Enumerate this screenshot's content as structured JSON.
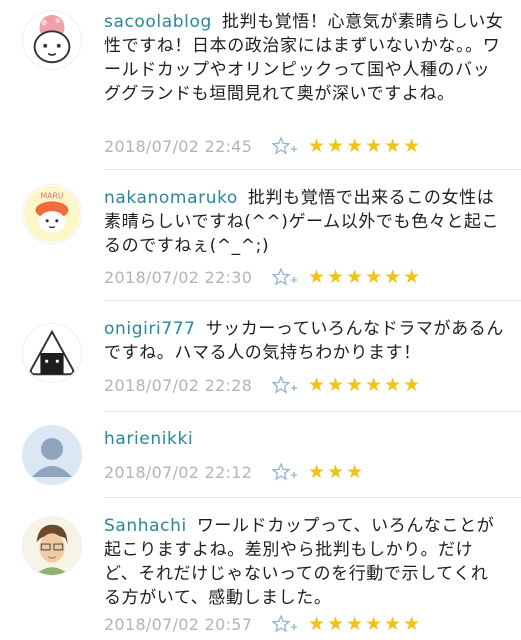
{
  "comments": [
    {
      "username": "sacoolablog",
      "text": "批判も覚悟！心意気が素晴らしい女性ですね！日本の政治家にはまずいないかな。。ワールドカップやオリンピックって国や人種のバッググランドも垣間見れて奥が深いですよね。",
      "timestamp": "2018/07/02 22:45",
      "stars": "★★★★★★",
      "rating": 6,
      "avatar_icon": "pink-hair-girl-avatar"
    },
    {
      "username": "nakanomaruko",
      "text": "批判も覚悟で出来るこの女性は素晴らしいですね(^^)ゲーム以外でも色々と起こるのですねぇ(^_^;)",
      "timestamp": "2018/07/02 22:30",
      "stars": "★★★★★★",
      "rating": 6,
      "avatar_icon": "maru-character-avatar",
      "avatar_text": "MARU"
    },
    {
      "username": "onigiri777",
      "text": "サッカーっていろんなドラマがあるんですね。ハマる人の気持ちわかります！",
      "timestamp": "2018/07/02 22:28",
      "stars": "★★★★★★",
      "rating": 6,
      "avatar_icon": "onigiri-avatar"
    },
    {
      "username": "harienikki",
      "text": "",
      "timestamp": "2018/07/02 22:12",
      "stars": "★★★",
      "rating": 3,
      "avatar_icon": "default-user-avatar"
    },
    {
      "username": "Sanhachi",
      "text": "ワールドカップって、いろんなことが起こりますよね。差別やら批判もしかり。だけど、それだけじゃないってのを行動で示してくれる方がいて、感動しました。",
      "timestamp": "2018/07/02 20:57",
      "stars": "★★★★★★",
      "rating": 6,
      "avatar_icon": "man-illustration-avatar"
    }
  ],
  "colors": {
    "username": "#27889a",
    "timestamp": "#b4b4b4",
    "star": "#f2c315",
    "favorite_icon": "#8fb4dc"
  }
}
